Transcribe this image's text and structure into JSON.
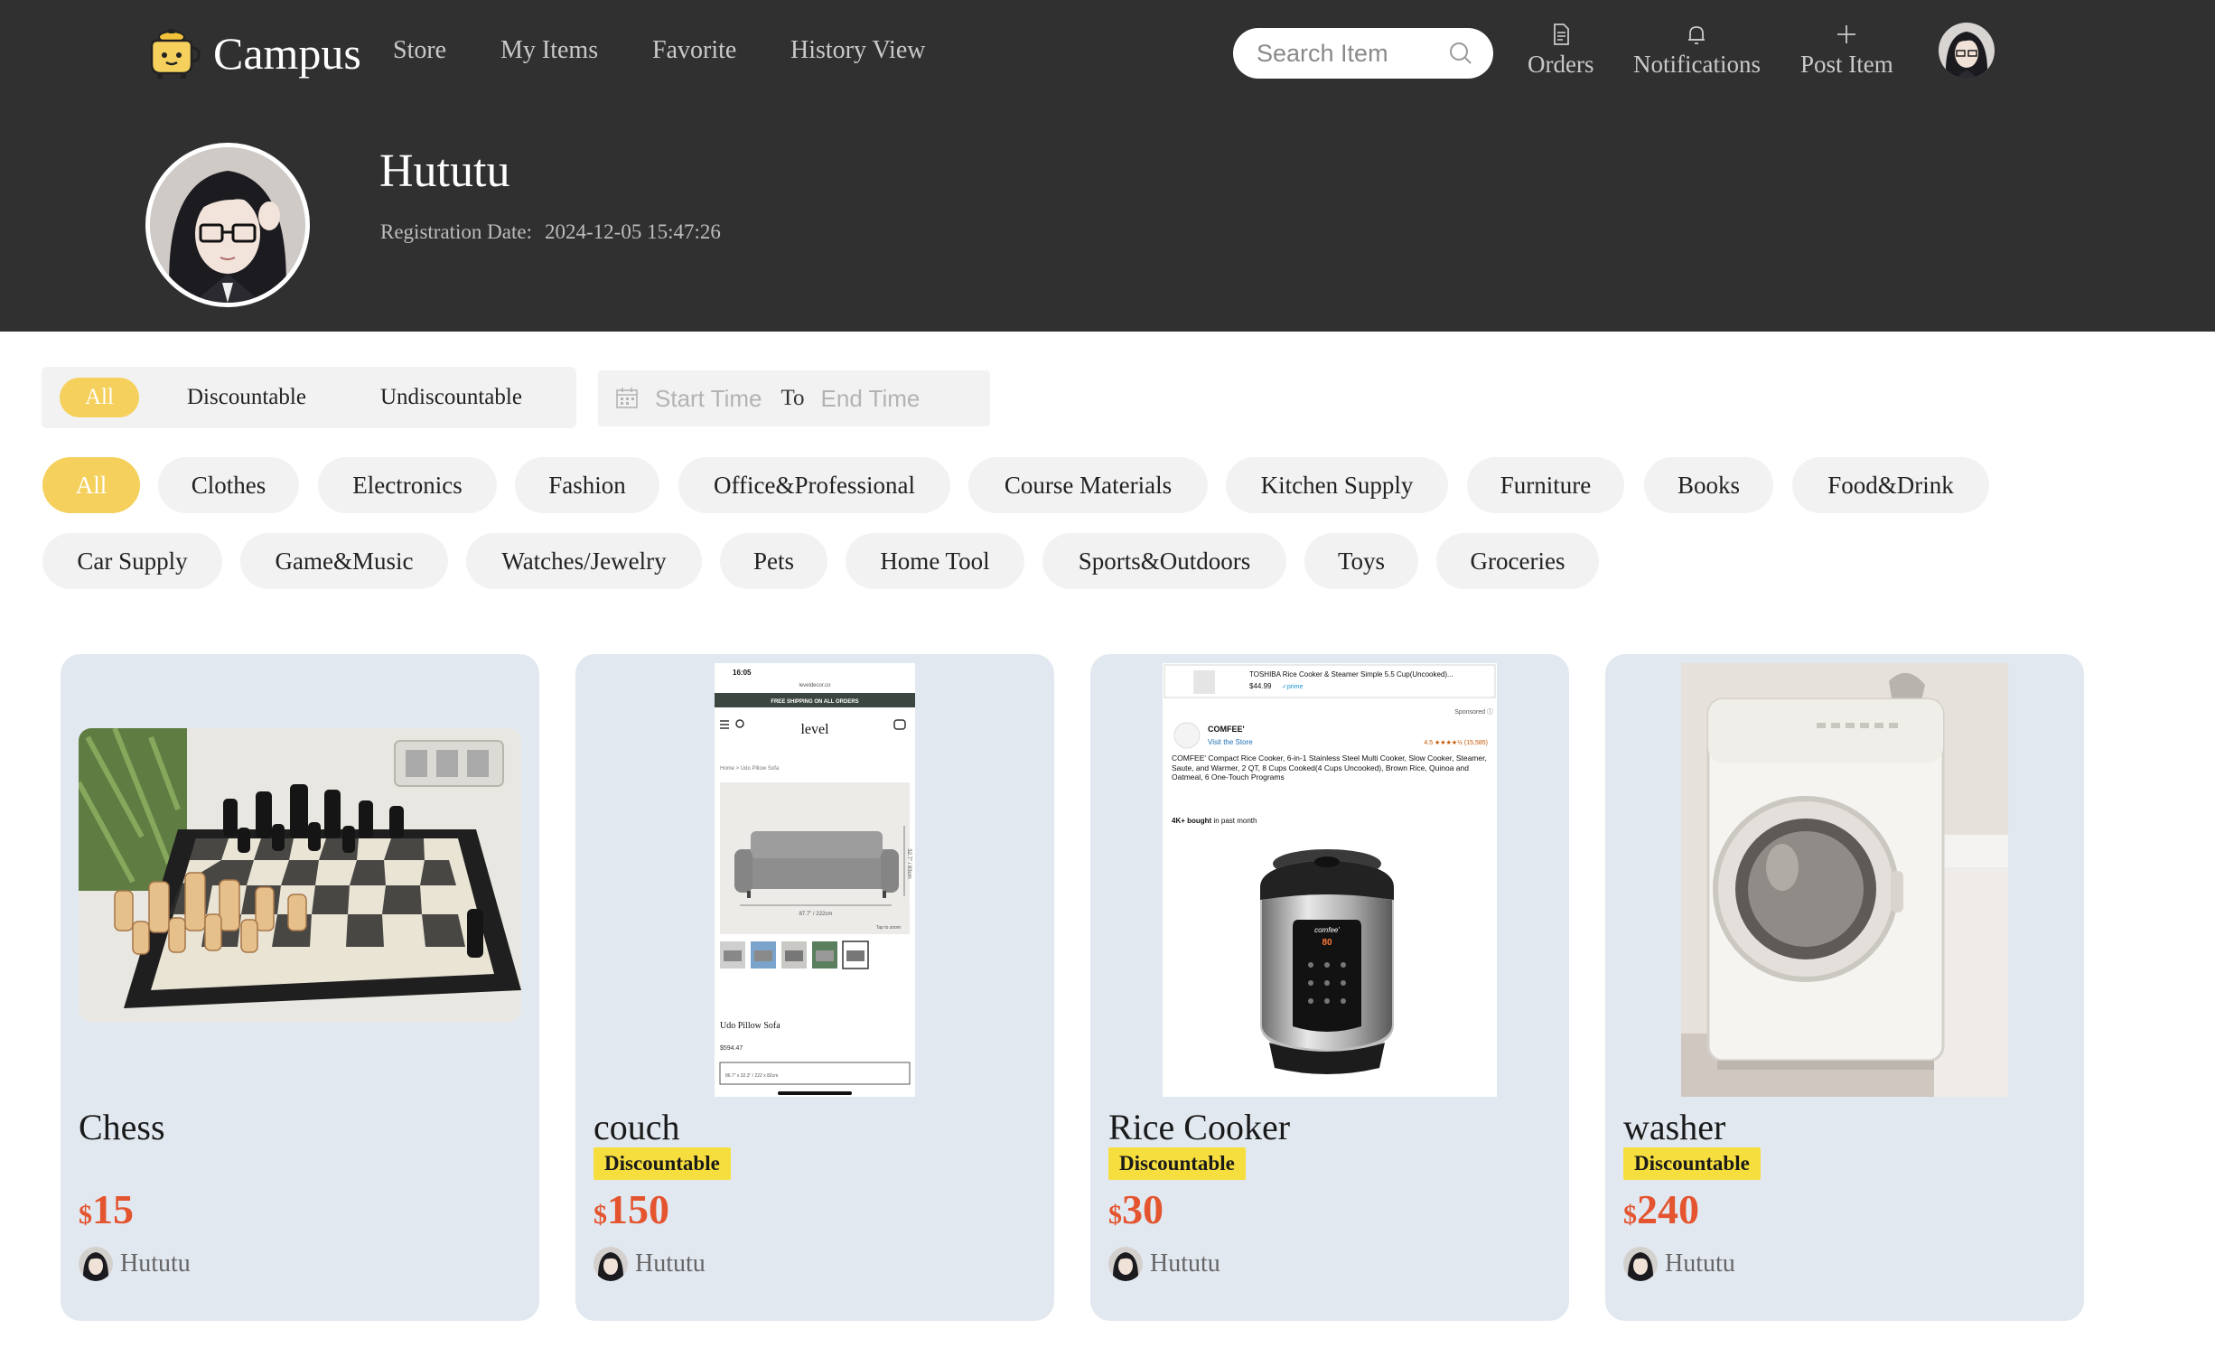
{
  "app": {
    "name": "Campus"
  },
  "nav": {
    "links": [
      "Store",
      "My Items",
      "Favorite",
      "History View"
    ]
  },
  "search": {
    "placeholder": "Search Item"
  },
  "header_actions": {
    "orders": "Orders",
    "notifications": "Notifications",
    "post": "Post Item"
  },
  "profile": {
    "name": "Hututu",
    "reg_label": "Registration Date:",
    "reg_date": "2024-12-05 15:47:26"
  },
  "discount_filter": {
    "options": [
      "All",
      "Discountable",
      "Undiscountable"
    ],
    "selected": "All"
  },
  "date_range": {
    "start_placeholder": "Start Time",
    "separator": "To",
    "end_placeholder": "End Time"
  },
  "categories": {
    "selected": "All",
    "row1": [
      "All",
      "Clothes",
      "Electronics",
      "Fashion",
      "Office&Professional",
      "Course Materials",
      "Kitchen Supply",
      "Furniture",
      "Books",
      "Food&Drink"
    ],
    "row2": [
      "Car Supply",
      "Game&Music",
      "Watches/Jewelry",
      "Pets",
      "Home Tool",
      "Sports&Outdoors",
      "Toys",
      "Groceries"
    ]
  },
  "items": [
    {
      "title": "Chess",
      "badge": "",
      "currency": "$",
      "price": "15",
      "seller": "Hututu",
      "image": "chess-board-photo"
    },
    {
      "title": "couch",
      "badge": "Discountable",
      "currency": "$",
      "price": "150",
      "seller": "Hututu",
      "image": "sofa-screenshot",
      "image_text": {
        "time": "16:05",
        "site": "leveldecor.co",
        "banner": "FREE SHIPPING ON ALL ORDERS",
        "brand": "level",
        "breadcrumb": "Home > Udo Pillow Sofa",
        "product": "Udo Pillow Sofa",
        "price": "$594.47",
        "dim_w": "87.7\" / 222cm",
        "dim_h": "32.7\" / 83cm",
        "size": "86.7\" x 32.3\" / 222 x 82cm",
        "zoom": "Tap to zoom"
      }
    },
    {
      "title": "Rice Cooker",
      "badge": "Discountable",
      "currency": "$",
      "price": "30",
      "seller": "Hututu",
      "image": "rice-cooker-screenshot",
      "image_text": {
        "top_title": "TOSHIBA Rice Cooker & Steamer Simple 5.5 Cup(Uncooked)...",
        "top_price": "$44.99",
        "prime": "✓prime",
        "sponsored": "Sponsored ⓘ",
        "brand": "COMFEE'",
        "visit": "Visit the Store",
        "rating": "4.5 ★★★★½ (15,585)",
        "desc": "COMFEE' Compact Rice Cooker, 6-in-1 Stainless Steel Multi Cooker, Slow Cooker, Steamer, Saute, and Warmer, 2 QT, 8 Cups Cooked(4 Cups Uncooked), Brown Rice, Quinoa and Oatmeal, 6 One-Touch Programs",
        "bought_bold": "4K+ bought",
        "bought_rest": "in past month",
        "display": "80",
        "logo": "comfee'"
      }
    },
    {
      "title": "washer",
      "badge": "Discountable",
      "currency": "$",
      "price": "240",
      "seller": "Hututu",
      "image": "washing-machine-photo"
    }
  ],
  "colors": {
    "header_bg": "#303030",
    "accent": "#f5d05c",
    "price": "#e3542f",
    "badge": "#f6de3e",
    "card_bg": "#e2e8f0"
  }
}
